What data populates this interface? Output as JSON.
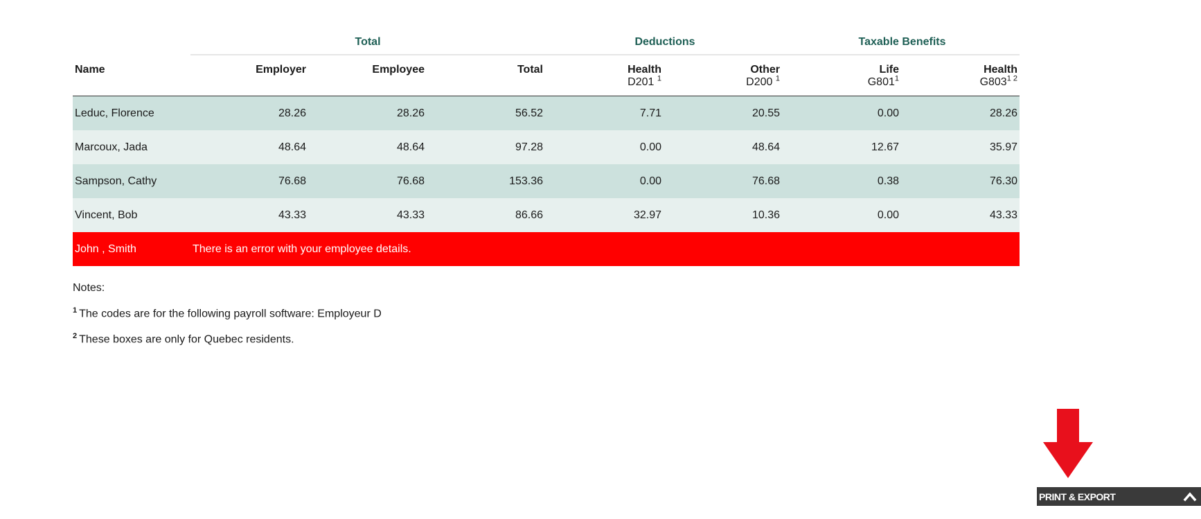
{
  "groups": {
    "total": "Total",
    "deductions": "Deductions",
    "taxable_benefits": "Taxable Benefits"
  },
  "headers": {
    "name": "Name",
    "employer": "Employer",
    "employee": "Employee",
    "total": "Total",
    "health_deduction": {
      "label": "Health",
      "code": "D201",
      "sup": "1"
    },
    "other_deduction": {
      "label": "Other",
      "code": "D200",
      "sup": "1"
    },
    "life_benefit": {
      "label": "Life",
      "code": "G801",
      "sup": "1"
    },
    "health_benefit": {
      "label": "Health",
      "code": "G803",
      "sup": "1 2"
    }
  },
  "rows": [
    {
      "name": "Leduc, Florence",
      "employer": "28.26",
      "employee": "28.26",
      "total": "56.52",
      "health_ded": "7.71",
      "other_ded": "20.55",
      "life": "0.00",
      "health_ben": "28.26"
    },
    {
      "name": "Marcoux, Jada",
      "employer": "48.64",
      "employee": "48.64",
      "total": "97.28",
      "health_ded": "0.00",
      "other_ded": "48.64",
      "life": "12.67",
      "health_ben": "35.97"
    },
    {
      "name": "Sampson, Cathy",
      "employer": "76.68",
      "employee": "76.68",
      "total": "153.36",
      "health_ded": "0.00",
      "other_ded": "76.68",
      "life": "0.38",
      "health_ben": "76.30"
    },
    {
      "name": "Vincent, Bob",
      "employer": "43.33",
      "employee": "43.33",
      "total": "86.66",
      "health_ded": "32.97",
      "other_ded": "10.36",
      "life": "0.00",
      "health_ben": "43.33"
    }
  ],
  "error_row": {
    "name": "John , Smith",
    "message": "There is an error with your employee details."
  },
  "notes": {
    "title": "Notes:",
    "items": [
      {
        "sup": "1",
        "text": "The codes are for the following payroll software: Employeur D"
      },
      {
        "sup": "2",
        "text": "These boxes are only for Quebec residents."
      }
    ]
  },
  "print_export": {
    "label": "PRINT & EXPORT",
    "icon": "chevron-up-icon"
  },
  "colors": {
    "group_header": "#1e5f55",
    "row_odd": "#cce1dd",
    "row_even": "#e7f0ee",
    "error": "#ff0000",
    "arrow": "#e8101c",
    "print_bar": "#3a3a3a"
  }
}
